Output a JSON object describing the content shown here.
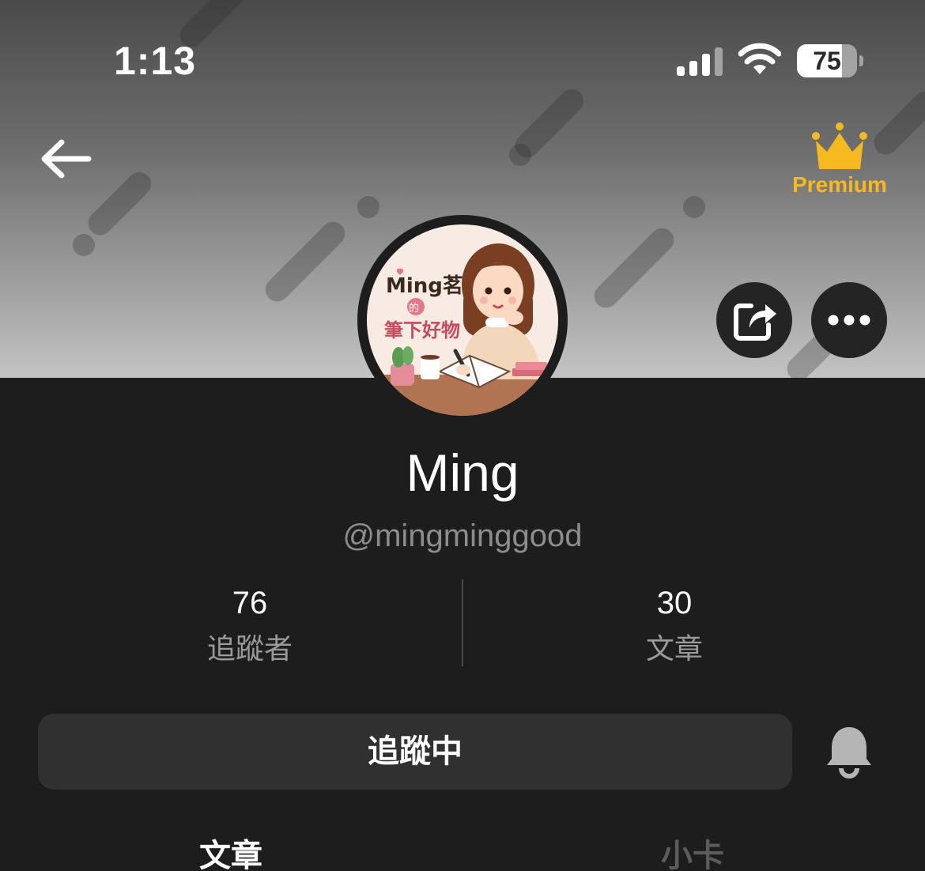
{
  "status_bar": {
    "time": "1:13",
    "battery_level": "75"
  },
  "header": {
    "premium_label": "Premium"
  },
  "profile": {
    "name": "Ming",
    "handle": "@mingminggood",
    "avatar_text": [
      "Ming茗",
      "的",
      "筆下好物"
    ]
  },
  "stats": {
    "followers_count": "76",
    "followers_label": "追蹤者",
    "articles_count": "30",
    "articles_label": "文章"
  },
  "actions": {
    "follow_label": "追蹤中"
  },
  "tabs": [
    {
      "label": "文章",
      "active": true
    },
    {
      "label": "小卡",
      "active": false
    }
  ],
  "colors": {
    "accent": "#f6b91f",
    "background": "#1d1d1d",
    "button": "#303030"
  }
}
